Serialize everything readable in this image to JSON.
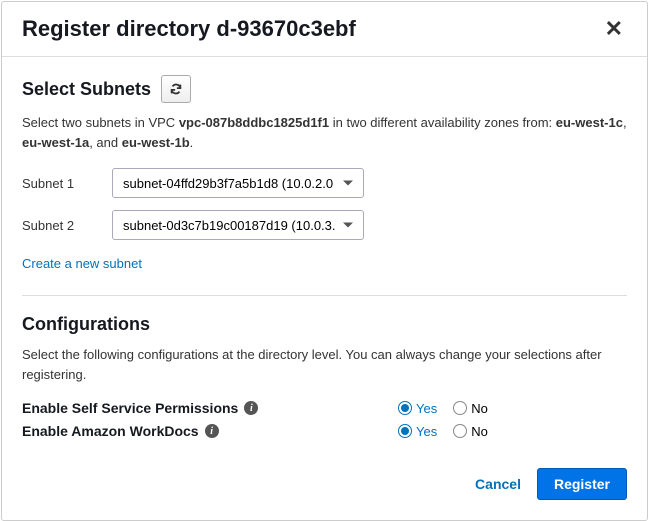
{
  "header": {
    "title": "Register directory d-93670c3ebf"
  },
  "subnets": {
    "title": "Select Subnets",
    "desc_prefix": "Select two subnets in VPC ",
    "vpc_id": "vpc-087b8ddbc1825d1f1",
    "desc_mid": " in two different availability zones from: ",
    "az1": "eu-west-1c",
    "comma": ", ",
    "az2": "eu-west-1a",
    "and": ", and ",
    "az3": "eu-west-1b",
    "period": ".",
    "subnet1_label": "Subnet 1",
    "subnet1_value": "subnet-04ffd29b3f7a5b1d8 (10.0.2.0",
    "subnet2_label": "Subnet 2",
    "subnet2_value": "subnet-0d3c7b19c00187d19 (10.0.3.",
    "create_link": "Create a new subnet"
  },
  "config": {
    "title": "Configurations",
    "desc": "Select the following configurations at the directory level. You can always change your selections after registering.",
    "self_service_label": "Enable Self Service Permissions",
    "workdocs_label": "Enable Amazon WorkDocs",
    "yes": "Yes",
    "no": "No"
  },
  "footer": {
    "cancel": "Cancel",
    "register": "Register"
  }
}
